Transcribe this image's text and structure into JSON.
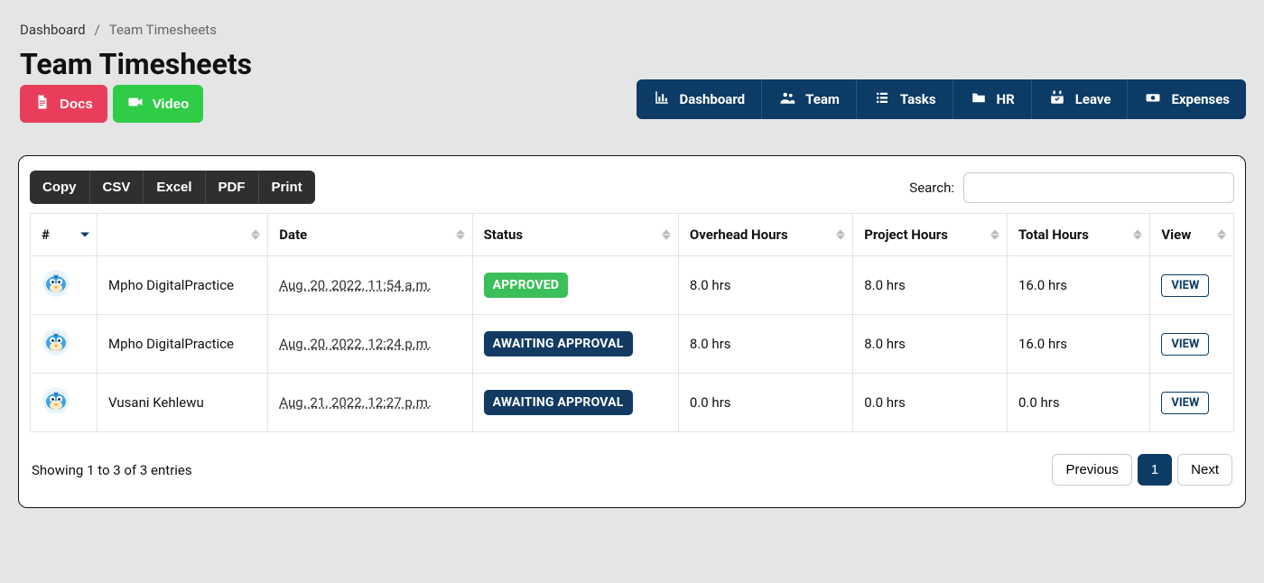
{
  "breadcrumb": {
    "root": "Dashboard",
    "sep": "/",
    "current": "Team Timesheets"
  },
  "page": {
    "title": "Team Timesheets"
  },
  "titleButtons": {
    "docs": "Docs",
    "video": "Video"
  },
  "nav": {
    "items": [
      "Dashboard",
      "Team",
      "Tasks",
      "HR",
      "Leave",
      "Expenses"
    ]
  },
  "toolbar": {
    "buttons": [
      "Copy",
      "CSV",
      "Excel",
      "PDF",
      "Print"
    ],
    "search_label": "Search:"
  },
  "table": {
    "columns": {
      "idx": "#",
      "name": "",
      "date": "Date",
      "status": "Status",
      "overhead": "Overhead Hours",
      "project": "Project Hours",
      "total": "Total Hours",
      "view": "View"
    },
    "view_label": "VIEW",
    "status_labels": {
      "approved": "APPROVED",
      "await": "AWAITING APPROVAL"
    },
    "rows": [
      {
        "name": "Mpho DigitalPractice",
        "date": "Aug. 20, 2022, 11:54 a.m.",
        "status": "approved",
        "overhead": "8.0 hrs",
        "project": "8.0 hrs",
        "total": "16.0 hrs"
      },
      {
        "name": "Mpho DigitalPractice",
        "date": "Aug. 20, 2022, 12:24 p.m.",
        "status": "await",
        "overhead": "8.0 hrs",
        "project": "8.0 hrs",
        "total": "16.0 hrs"
      },
      {
        "name": "Vusani Kehlewu",
        "date": "Aug. 21, 2022, 12:27 p.m.",
        "status": "await",
        "overhead": "0.0 hrs",
        "project": "0.0 hrs",
        "total": "0.0 hrs"
      }
    ]
  },
  "footer": {
    "info": "Showing 1 to 3 of 3 entries",
    "prev": "Previous",
    "page": "1",
    "next": "Next"
  }
}
